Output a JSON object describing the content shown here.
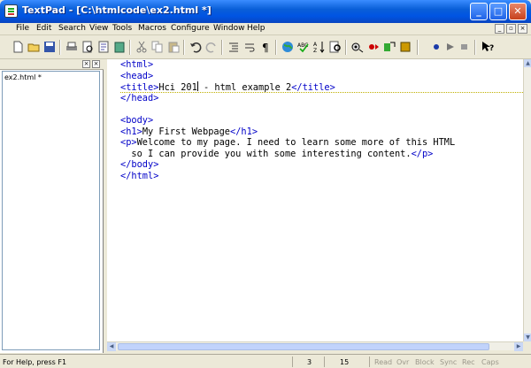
{
  "window": {
    "title": "TextPad - [C:\\htmlcode\\ex2.html *]"
  },
  "title_buttons": {
    "minimize": "_",
    "maximize": "□",
    "close": "✕"
  },
  "menu": [
    "File",
    "Edit",
    "Search",
    "View",
    "Tools",
    "Macros",
    "Configure",
    "Window",
    "Help"
  ],
  "doc_controls": {
    "minimize": "_",
    "restore": "▫",
    "close": "×"
  },
  "toolbar": {
    "icons": [
      "new-file-icon",
      "open-folder-icon",
      "save-icon",
      "print-icon",
      "print-preview-icon",
      "page-icon",
      "clipboard-icon",
      "cut-icon",
      "copy-icon",
      "paste-icon",
      "undo-icon",
      "redo-icon",
      "indent-icon",
      "paragraph-icon",
      "web-icon",
      "spellcheck-icon",
      "sort-icon",
      "find-icon",
      "find-next-icon",
      "replace-icon",
      "macro-icon",
      "record-icon",
      "play-icon",
      "stop-icon",
      "help-pointer-icon"
    ]
  },
  "sidebar": {
    "documents": [
      "ex2.html *"
    ],
    "pin": "×",
    "close": "×"
  },
  "editor": {
    "lines": [
      [
        {
          "t": "<html>",
          "tag": true
        }
      ],
      [
        {
          "t": "<head>",
          "tag": true
        }
      ],
      [
        {
          "t": "<title>",
          "tag": true
        },
        {
          "t": "Hci 201",
          "tag": false
        },
        {
          "t": "|caret|",
          "tag": false
        },
        {
          "t": " - html example 2",
          "tag": false
        },
        {
          "t": "</title>",
          "tag": true
        }
      ],
      [
        {
          "t": "</head>",
          "tag": true
        }
      ],
      [],
      [
        {
          "t": "<body>",
          "tag": true
        }
      ],
      [
        {
          "t": "<h1>",
          "tag": true
        },
        {
          "t": "My First Webpage",
          "tag": false
        },
        {
          "t": "</h1>",
          "tag": true
        }
      ],
      [
        {
          "t": "<p>",
          "tag": true
        },
        {
          "t": "Welcome to my page. I need to learn some more of this HTML",
          "tag": false
        }
      ],
      [
        {
          "t": "  so I can provide you with some interesting content.",
          "tag": false
        },
        {
          "t": "</p>",
          "tag": true
        }
      ],
      [
        {
          "t": "</body>",
          "tag": true
        }
      ],
      [
        {
          "t": "</html>",
          "tag": true
        }
      ]
    ]
  },
  "status": {
    "help": "For Help, press F1",
    "line": "3",
    "column": "15",
    "flags": [
      "Read",
      "Ovr",
      "Block",
      "Sync",
      "Rec",
      "Caps"
    ]
  }
}
